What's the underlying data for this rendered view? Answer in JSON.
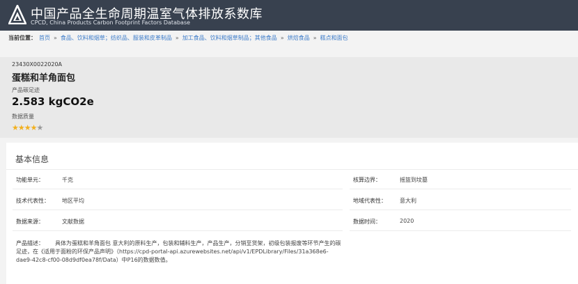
{
  "header": {
    "title_zh": "中国产品全生命周期温室气体排放系数库",
    "title_en": "CPCD, China Products Carbon Footprint Factors Database"
  },
  "breadcrumb": {
    "label": "当前位置：",
    "items": [
      "首页",
      "食品、饮料和烟草；纺织品、服装和皮革制品",
      "加工食品、饮料和烟草制品；其他食品",
      "烘焙食品",
      "糕点和面包"
    ]
  },
  "product": {
    "code": "23430X0022020A",
    "name": "蛋糕和羊角面包",
    "cf_label": "产品碳足迹",
    "cf_value": "2.583 kgCO2e",
    "dq_label": "数据质量",
    "rating": 4,
    "rating_max": 5
  },
  "basic_info": {
    "title": "基本信息",
    "functional_unit_label": "功能单元：",
    "functional_unit": "千克",
    "accounting_boundary_label": "核算边界：",
    "accounting_boundary": "摇篮到坟墓",
    "tech_rep_label": "技术代表性：",
    "tech_rep": "地区平均",
    "geo_rep_label": "地域代表性：",
    "geo_rep": "意大利",
    "data_source_label": "数据来源：",
    "data_source": "文献数据",
    "data_time_label": "数据时间：",
    "data_time": "2020",
    "desc_label": "产品描述：",
    "desc_text": "具体为蛋糕和羊角面包 意大利的原料生产，包装和辅料生产，产品生产，分销至货架，初级包装报废等环节产生的碳足迹，在《适用于面粉的环保产品声明》（https://cpd-portal-api.azurewebsites.net/api/v1/EPDLibrary/Files/31a368e6-dae9-42c8-cf00-08d9df0ea78f/Data）中P16的数据数值。"
  },
  "colors": {
    "header_bg": "#38414f",
    "link": "#3d7cc9",
    "star_on": "#f2b01e",
    "star_off": "#9a9a9a"
  },
  "icons": [
    "logo-icon",
    "star-icon"
  ]
}
